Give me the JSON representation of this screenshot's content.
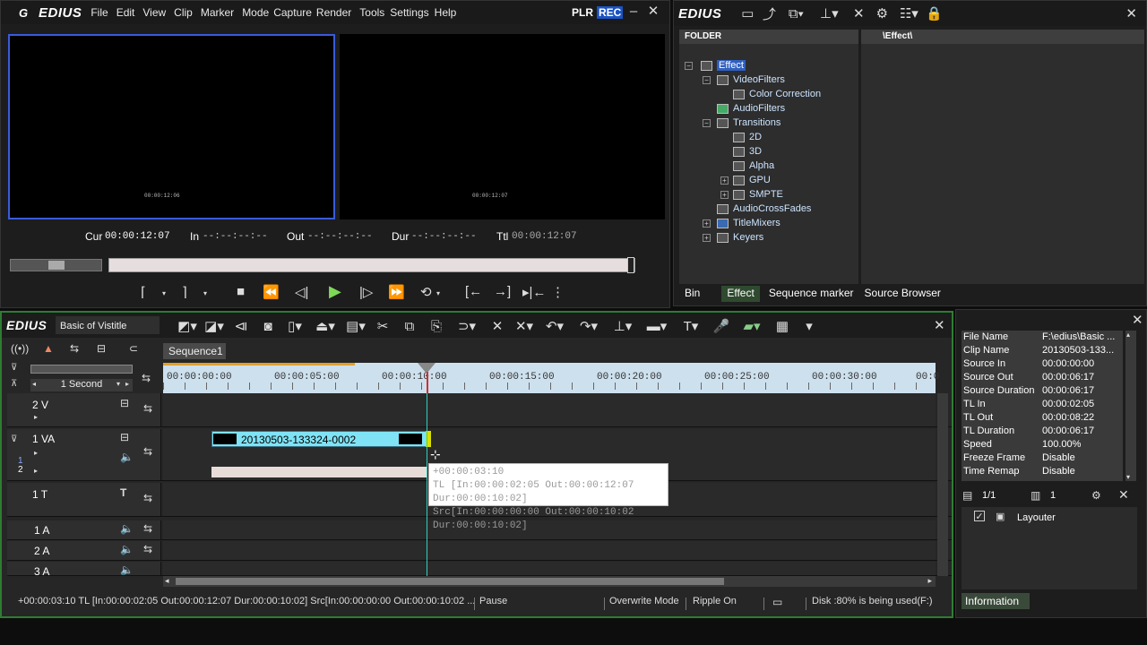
{
  "player": {
    "logo": "EDIUS",
    "menu": [
      "File",
      "Edit",
      "View",
      "Clip",
      "Marker",
      "Mode",
      "Capture",
      "Render",
      "Tools",
      "Settings",
      "Help"
    ],
    "plr": "PLR",
    "rec": "REC",
    "overlay_tc_left": "00:00:12:06",
    "overlay_tc_right": "00:00:12:07",
    "cur_label": "Cur",
    "cur_value": "00:00:12:07",
    "in_label": "In",
    "in_value": "--:--:--:--",
    "out_label": "Out",
    "out_value": "--:--:--:--",
    "dur_label": "Dur",
    "dur_value": "--:--:--:--",
    "ttl_label": "Ttl",
    "ttl_value": "00:00:12:07"
  },
  "bin": {
    "logo": "EDIUS",
    "folder_header": "FOLDER",
    "path_header": "\\Effect\\",
    "tree": [
      "Effect",
      "VideoFilters",
      "Color Correction",
      "AudioFilters",
      "Transitions",
      "2D",
      "3D",
      "Alpha",
      "GPU",
      "SMPTE",
      "AudioCrossFades",
      "TitleMixers",
      "Keyers"
    ],
    "tabs": [
      "Bin",
      "Effect",
      "Sequence marker",
      "Source Browser"
    ]
  },
  "timeline": {
    "logo": "EDIUS",
    "project_name": "Basic of Vistitle",
    "sequence_tab": "Sequence1",
    "scale": "1 Second",
    "ruler": [
      "00:00:00:00",
      "00:00:05:00",
      "00:00:10:00",
      "00:00:15:00",
      "00:00:20:00",
      "00:00:25:00",
      "00:00:30:00",
      "00:0"
    ],
    "tracks": {
      "v2": "2 V",
      "va1": "1 VA",
      "va1_sub": "1",
      "va1_sub2": "2",
      "t1": "1 T",
      "a1": "1 A",
      "a2": "2 A",
      "a3": "3 A"
    },
    "clip_name": "20130503-133324-0002",
    "tooltip": {
      "line1": "+00:00:03:10",
      "line2": "TL [In:00:00:02:05 Out:00:00:12:07 Dur:00:00:10:02]",
      "line3": "Src[In:00:00:00:00 Out:00:00:10:02 Dur:00:00:10:02]"
    }
  },
  "info": {
    "rows": [
      {
        "k": "File Name",
        "v": "F:\\edius\\Basic ..."
      },
      {
        "k": "Clip Name",
        "v": "20130503-133..."
      },
      {
        "k": "Source In",
        "v": "00:00:00:00"
      },
      {
        "k": "Source Out",
        "v": "00:00:06:17"
      },
      {
        "k": "Source Duration",
        "v": "00:00:06:17"
      },
      {
        "k": "TL In",
        "v": "00:00:02:05"
      },
      {
        "k": "TL Out",
        "v": "00:00:08:22"
      },
      {
        "k": "TL Duration",
        "v": "00:00:06:17"
      },
      {
        "k": "Speed",
        "v": "100.00%"
      },
      {
        "k": "Freeze Frame",
        "v": "Disable"
      },
      {
        "k": "Time Remap",
        "v": "Disable"
      }
    ],
    "page": "1/1",
    "count": "1",
    "layouter": "Layouter",
    "tab": "Information"
  },
  "status": {
    "text": "+00:00:03:10 TL [In:00:00:02:05 Out:00:00:12:07 Dur:00:00:10:02] Src[In:00:00:00:00 Out:00:00:10:02 ...",
    "pause": "Pause",
    "overwrite": "Overwrite Mode",
    "ripple": "Ripple On",
    "disk": "Disk :80% is being used(F:)"
  },
  "colors": {
    "accent_green": "#2e7d32",
    "clip_cyan": "#7fe3f5",
    "playhead": "#d23030",
    "monitor_border": "#3a5bd9",
    "rec_bg": "#1a53c4"
  }
}
